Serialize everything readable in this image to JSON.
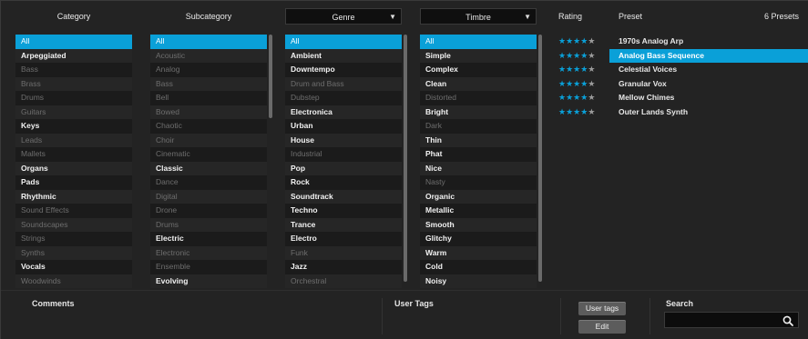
{
  "columns": {
    "category": {
      "header": "Category",
      "items": [
        {
          "label": "All",
          "state": "sel"
        },
        {
          "label": "Arpeggiated",
          "state": "hi"
        },
        {
          "label": "Bass",
          "state": "dim"
        },
        {
          "label": "Brass",
          "state": "dim"
        },
        {
          "label": "Drums",
          "state": "dim"
        },
        {
          "label": "Guitars",
          "state": "dim"
        },
        {
          "label": "Keys",
          "state": "hi"
        },
        {
          "label": "Leads",
          "state": "dim"
        },
        {
          "label": "Mallets",
          "state": "dim"
        },
        {
          "label": "Organs",
          "state": "hi"
        },
        {
          "label": "Pads",
          "state": "hi"
        },
        {
          "label": "Rhythmic",
          "state": "hi"
        },
        {
          "label": "Sound Effects",
          "state": "dim"
        },
        {
          "label": "Soundscapes",
          "state": "dim"
        },
        {
          "label": "Strings",
          "state": "dim"
        },
        {
          "label": "Synths",
          "state": "dim"
        },
        {
          "label": "Vocals",
          "state": "hi"
        },
        {
          "label": "Woodwinds",
          "state": "dim"
        }
      ]
    },
    "subcategory": {
      "header": "Subcategory",
      "items": [
        {
          "label": "All",
          "state": "sel"
        },
        {
          "label": "Acoustic",
          "state": "dim"
        },
        {
          "label": "Analog",
          "state": "dim"
        },
        {
          "label": "Bass",
          "state": "dim"
        },
        {
          "label": "Bell",
          "state": "dim"
        },
        {
          "label": "Bowed",
          "state": "dim"
        },
        {
          "label": "Chaotic",
          "state": "dim"
        },
        {
          "label": "Choir",
          "state": "dim"
        },
        {
          "label": "Cinematic",
          "state": "dim"
        },
        {
          "label": "Classic",
          "state": "hi"
        },
        {
          "label": "Dance",
          "state": "dim"
        },
        {
          "label": "Digital",
          "state": "dim"
        },
        {
          "label": "Drone",
          "state": "dim"
        },
        {
          "label": "Drums",
          "state": "dim"
        },
        {
          "label": "Electric",
          "state": "hi"
        },
        {
          "label": "Electronic",
          "state": "dim"
        },
        {
          "label": "Ensemble",
          "state": "dim"
        },
        {
          "label": "Evolving",
          "state": "hi"
        }
      ]
    },
    "genre": {
      "header": "Genre",
      "items": [
        {
          "label": "All",
          "state": "sel"
        },
        {
          "label": "Ambient",
          "state": "hi"
        },
        {
          "label": "Downtempo",
          "state": "hi"
        },
        {
          "label": "Drum and Bass",
          "state": "dim"
        },
        {
          "label": "Dubstep",
          "state": "dim"
        },
        {
          "label": "Electronica",
          "state": "hi"
        },
        {
          "label": "Urban",
          "state": "hi"
        },
        {
          "label": "House",
          "state": "hi"
        },
        {
          "label": "Industrial",
          "state": "dim"
        },
        {
          "label": "Pop",
          "state": "hi"
        },
        {
          "label": "Rock",
          "state": "hi"
        },
        {
          "label": "Soundtrack",
          "state": "hi"
        },
        {
          "label": "Techno",
          "state": "hi"
        },
        {
          "label": "Trance",
          "state": "hi"
        },
        {
          "label": "Electro",
          "state": "hi"
        },
        {
          "label": "Funk",
          "state": "dim"
        },
        {
          "label": "Jazz",
          "state": "hi"
        },
        {
          "label": "Orchestral",
          "state": "dim"
        }
      ]
    },
    "timbre": {
      "header": "Timbre",
      "items": [
        {
          "label": "All",
          "state": "sel"
        },
        {
          "label": "Simple",
          "state": "hi"
        },
        {
          "label": "Complex",
          "state": "hi"
        },
        {
          "label": "Clean",
          "state": "hi"
        },
        {
          "label": "Distorted",
          "state": "dim"
        },
        {
          "label": "Bright",
          "state": "hi"
        },
        {
          "label": "Dark",
          "state": "dim"
        },
        {
          "label": "Thin",
          "state": "hi"
        },
        {
          "label": "Phat",
          "state": "hi"
        },
        {
          "label": "Nice",
          "state": "hi"
        },
        {
          "label": "Nasty",
          "state": "dim"
        },
        {
          "label": "Organic",
          "state": "hi"
        },
        {
          "label": "Metallic",
          "state": "hi"
        },
        {
          "label": "Smooth",
          "state": "hi"
        },
        {
          "label": "Glitchy",
          "state": "hi"
        },
        {
          "label": "Warm",
          "state": "hi"
        },
        {
          "label": "Cold",
          "state": "hi"
        },
        {
          "label": "Noisy",
          "state": "hi"
        }
      ]
    }
  },
  "presets": {
    "rating_header": "Rating",
    "preset_header": "Preset",
    "count": "6 Presets",
    "items": [
      {
        "name": "1970s Analog Arp",
        "rating": 4,
        "selected": false
      },
      {
        "name": "Analog Bass Sequence",
        "rating": 4,
        "selected": true
      },
      {
        "name": "Celestial Voices",
        "rating": 4,
        "selected": false
      },
      {
        "name": "Granular Vox",
        "rating": 4,
        "selected": false
      },
      {
        "name": "Mellow Chimes",
        "rating": 4,
        "selected": false
      },
      {
        "name": "Outer Lands Synth",
        "rating": 4,
        "selected": false
      }
    ]
  },
  "bottom": {
    "comments_label": "Comments",
    "user_tags_label": "User Tags",
    "user_tags_button": "User tags",
    "edit_button": "Edit",
    "search_label": "Search",
    "search_value": ""
  },
  "colors": {
    "accent": "#0aa0d8",
    "star_off": "#9b9b9b"
  }
}
